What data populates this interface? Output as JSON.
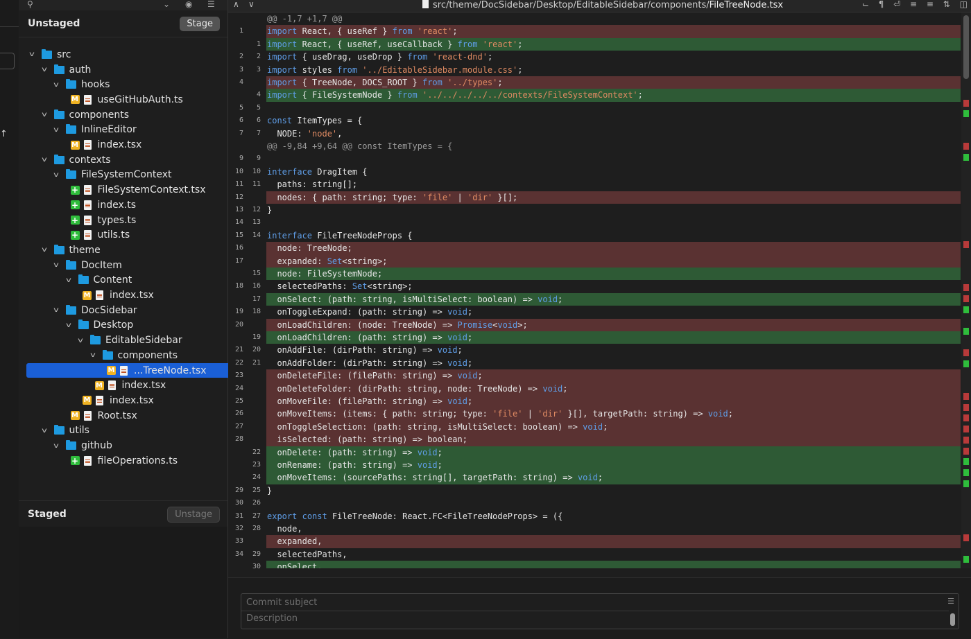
{
  "file_panel": {
    "unstaged_title": "Unstaged",
    "stage_button": "Stage",
    "staged_title": "Staged",
    "unstage_button": "Unstage",
    "tree": [
      {
        "label": "src",
        "type": "folder",
        "depth": 0
      },
      {
        "label": "auth",
        "type": "folder",
        "depth": 1
      },
      {
        "label": "hooks",
        "type": "folder",
        "depth": 2
      },
      {
        "label": "useGitHubAuth.ts",
        "type": "file",
        "status": "M",
        "depth": 3
      },
      {
        "label": "components",
        "type": "folder",
        "depth": 1
      },
      {
        "label": "InlineEditor",
        "type": "folder",
        "depth": 2
      },
      {
        "label": "index.tsx",
        "type": "file",
        "status": "M",
        "depth": 3
      },
      {
        "label": "contexts",
        "type": "folder",
        "depth": 1
      },
      {
        "label": "FileSystemContext",
        "type": "folder",
        "depth": 2
      },
      {
        "label": "FileSystemContext.tsx",
        "type": "file",
        "status": "A",
        "depth": 3
      },
      {
        "label": "index.ts",
        "type": "file",
        "status": "A",
        "depth": 3
      },
      {
        "label": "types.ts",
        "type": "file",
        "status": "A",
        "depth": 3
      },
      {
        "label": "utils.ts",
        "type": "file",
        "status": "A",
        "depth": 3
      },
      {
        "label": "theme",
        "type": "folder",
        "depth": 1
      },
      {
        "label": "DocItem",
        "type": "folder",
        "depth": 2
      },
      {
        "label": "Content",
        "type": "folder",
        "depth": 3
      },
      {
        "label": "index.tsx",
        "type": "file",
        "status": "M",
        "depth": 4
      },
      {
        "label": "DocSidebar",
        "type": "folder",
        "depth": 2
      },
      {
        "label": "Desktop",
        "type": "folder",
        "depth": 3
      },
      {
        "label": "EditableSidebar",
        "type": "folder",
        "depth": 4
      },
      {
        "label": "components",
        "type": "folder",
        "depth": 5
      },
      {
        "label": "...TreeNode.tsx",
        "type": "file",
        "status": "M",
        "depth": 6,
        "selected": true
      },
      {
        "label": "index.tsx",
        "type": "file",
        "status": "M",
        "depth": 5
      },
      {
        "label": "index.tsx",
        "type": "file",
        "status": "M",
        "depth": 4
      },
      {
        "label": "Root.tsx",
        "type": "file",
        "status": "M",
        "depth": 3
      },
      {
        "label": "utils",
        "type": "folder",
        "depth": 1
      },
      {
        "label": "github",
        "type": "folder",
        "depth": 2
      },
      {
        "label": "fileOperations.ts",
        "type": "file",
        "status": "A",
        "depth": 3
      }
    ]
  },
  "diff": {
    "path_prefix": "src/theme/DocSidebar/Desktop/EditableSidebar/components/",
    "file_name": "FileTreeNode.tsx",
    "lines": [
      {
        "t": "hunk",
        "o": "",
        "n": "",
        "text": "@@ -1,7 +1,7 @@"
      },
      {
        "t": "del",
        "o": "1",
        "n": "",
        "text": "import React, { useRef } from 'react';"
      },
      {
        "t": "add",
        "o": "",
        "n": "1",
        "text": "import React, { useRef, useCallback } from 'react';"
      },
      {
        "t": "ctx",
        "o": "2",
        "n": "2",
        "text": "import { useDrag, useDrop } from 'react-dnd';"
      },
      {
        "t": "ctx",
        "o": "3",
        "n": "3",
        "text": "import styles from '../EditableSidebar.module.css';"
      },
      {
        "t": "del",
        "o": "4",
        "n": "",
        "text": "import { TreeNode, DOCS_ROOT } from '../types';"
      },
      {
        "t": "add",
        "o": "",
        "n": "4",
        "text": "import { FileSystemNode } from '../../../../../contexts/FileSystemContext';"
      },
      {
        "t": "ctx",
        "o": "5",
        "n": "5",
        "text": ""
      },
      {
        "t": "ctx",
        "o": "6",
        "n": "6",
        "text": "const ItemTypes = {"
      },
      {
        "t": "ctx",
        "o": "7",
        "n": "7",
        "text": "  NODE: 'node',"
      },
      {
        "t": "hunk",
        "o": "",
        "n": "",
        "text": "@@ -9,84 +9,64 @@ const ItemTypes = {"
      },
      {
        "t": "ctx",
        "o": "9",
        "n": "9",
        "text": ""
      },
      {
        "t": "ctx",
        "o": "10",
        "n": "10",
        "text": "interface DragItem {"
      },
      {
        "t": "ctx",
        "o": "11",
        "n": "11",
        "text": "  paths: string[];"
      },
      {
        "t": "del",
        "o": "12",
        "n": "",
        "text": "  nodes: { path: string; type: 'file' | 'dir' }[];"
      },
      {
        "t": "ctx",
        "o": "13",
        "n": "12",
        "text": "}"
      },
      {
        "t": "ctx",
        "o": "14",
        "n": "13",
        "text": ""
      },
      {
        "t": "ctx",
        "o": "15",
        "n": "14",
        "text": "interface FileTreeNodeProps {"
      },
      {
        "t": "del",
        "o": "16",
        "n": "",
        "text": "  node: TreeNode;"
      },
      {
        "t": "del",
        "o": "17",
        "n": "",
        "text": "  expanded: Set<string>;"
      },
      {
        "t": "add",
        "o": "",
        "n": "15",
        "text": "  node: FileSystemNode;"
      },
      {
        "t": "ctx",
        "o": "18",
        "n": "16",
        "text": "  selectedPaths: Set<string>;"
      },
      {
        "t": "add",
        "o": "",
        "n": "17",
        "text": "  onSelect: (path: string, isMultiSelect: boolean) => void;"
      },
      {
        "t": "ctx",
        "o": "19",
        "n": "18",
        "text": "  onToggleExpand: (path: string) => void;"
      },
      {
        "t": "del",
        "o": "20",
        "n": "",
        "text": "  onLoadChildren: (node: TreeNode) => Promise<void>;"
      },
      {
        "t": "add",
        "o": "",
        "n": "19",
        "text": "  onLoadChildren: (path: string) => void;"
      },
      {
        "t": "ctx",
        "o": "21",
        "n": "20",
        "text": "  onAddFile: (dirPath: string) => void;"
      },
      {
        "t": "ctx",
        "o": "22",
        "n": "21",
        "text": "  onAddFolder: (dirPath: string) => void;"
      },
      {
        "t": "del",
        "o": "23",
        "n": "",
        "text": "  onDeleteFile: (filePath: string) => void;"
      },
      {
        "t": "del",
        "o": "24",
        "n": "",
        "text": "  onDeleteFolder: (dirPath: string, node: TreeNode) => void;"
      },
      {
        "t": "del",
        "o": "25",
        "n": "",
        "text": "  onMoveFile: (filePath: string) => void;"
      },
      {
        "t": "del",
        "o": "26",
        "n": "",
        "text": "  onMoveItems: (items: { path: string; type: 'file' | 'dir' }[], targetPath: string) => void;"
      },
      {
        "t": "del",
        "o": "27",
        "n": "",
        "text": "  onToggleSelection: (path: string, isMultiSelect: boolean) => void;"
      },
      {
        "t": "del",
        "o": "28",
        "n": "",
        "text": "  isSelected: (path: string) => boolean;"
      },
      {
        "t": "add",
        "o": "",
        "n": "22",
        "text": "  onDelete: (path: string) => void;"
      },
      {
        "t": "add",
        "o": "",
        "n": "23",
        "text": "  onRename: (path: string) => void;"
      },
      {
        "t": "add",
        "o": "",
        "n": "24",
        "text": "  onMoveItems: (sourcePaths: string[], targetPath: string) => void;"
      },
      {
        "t": "ctx",
        "o": "29",
        "n": "25",
        "text": "}"
      },
      {
        "t": "ctx",
        "o": "30",
        "n": "26",
        "text": ""
      },
      {
        "t": "ctx",
        "o": "31",
        "n": "27",
        "text": "export const FileTreeNode: React.FC<FileTreeNodeProps> = ({"
      },
      {
        "t": "ctx",
        "o": "32",
        "n": "28",
        "text": "  node,"
      },
      {
        "t": "del",
        "o": "33",
        "n": "",
        "text": "  expanded,"
      },
      {
        "t": "ctx",
        "o": "34",
        "n": "29",
        "text": "  selectedPaths,"
      },
      {
        "t": "add",
        "o": "",
        "n": "30",
        "text": "  onSelect,"
      }
    ]
  },
  "commit": {
    "subject_placeholder": "Commit subject",
    "description_placeholder": "Description"
  },
  "colors": {
    "selected": "#1a5fd6",
    "deleted_bg": "#5a3232",
    "added_bg": "#2e5a35",
    "keyword": "#5f9ee8",
    "string": "#e08b63",
    "modified_badge": "#f0b323",
    "added_badge": "#2fbd3c"
  }
}
